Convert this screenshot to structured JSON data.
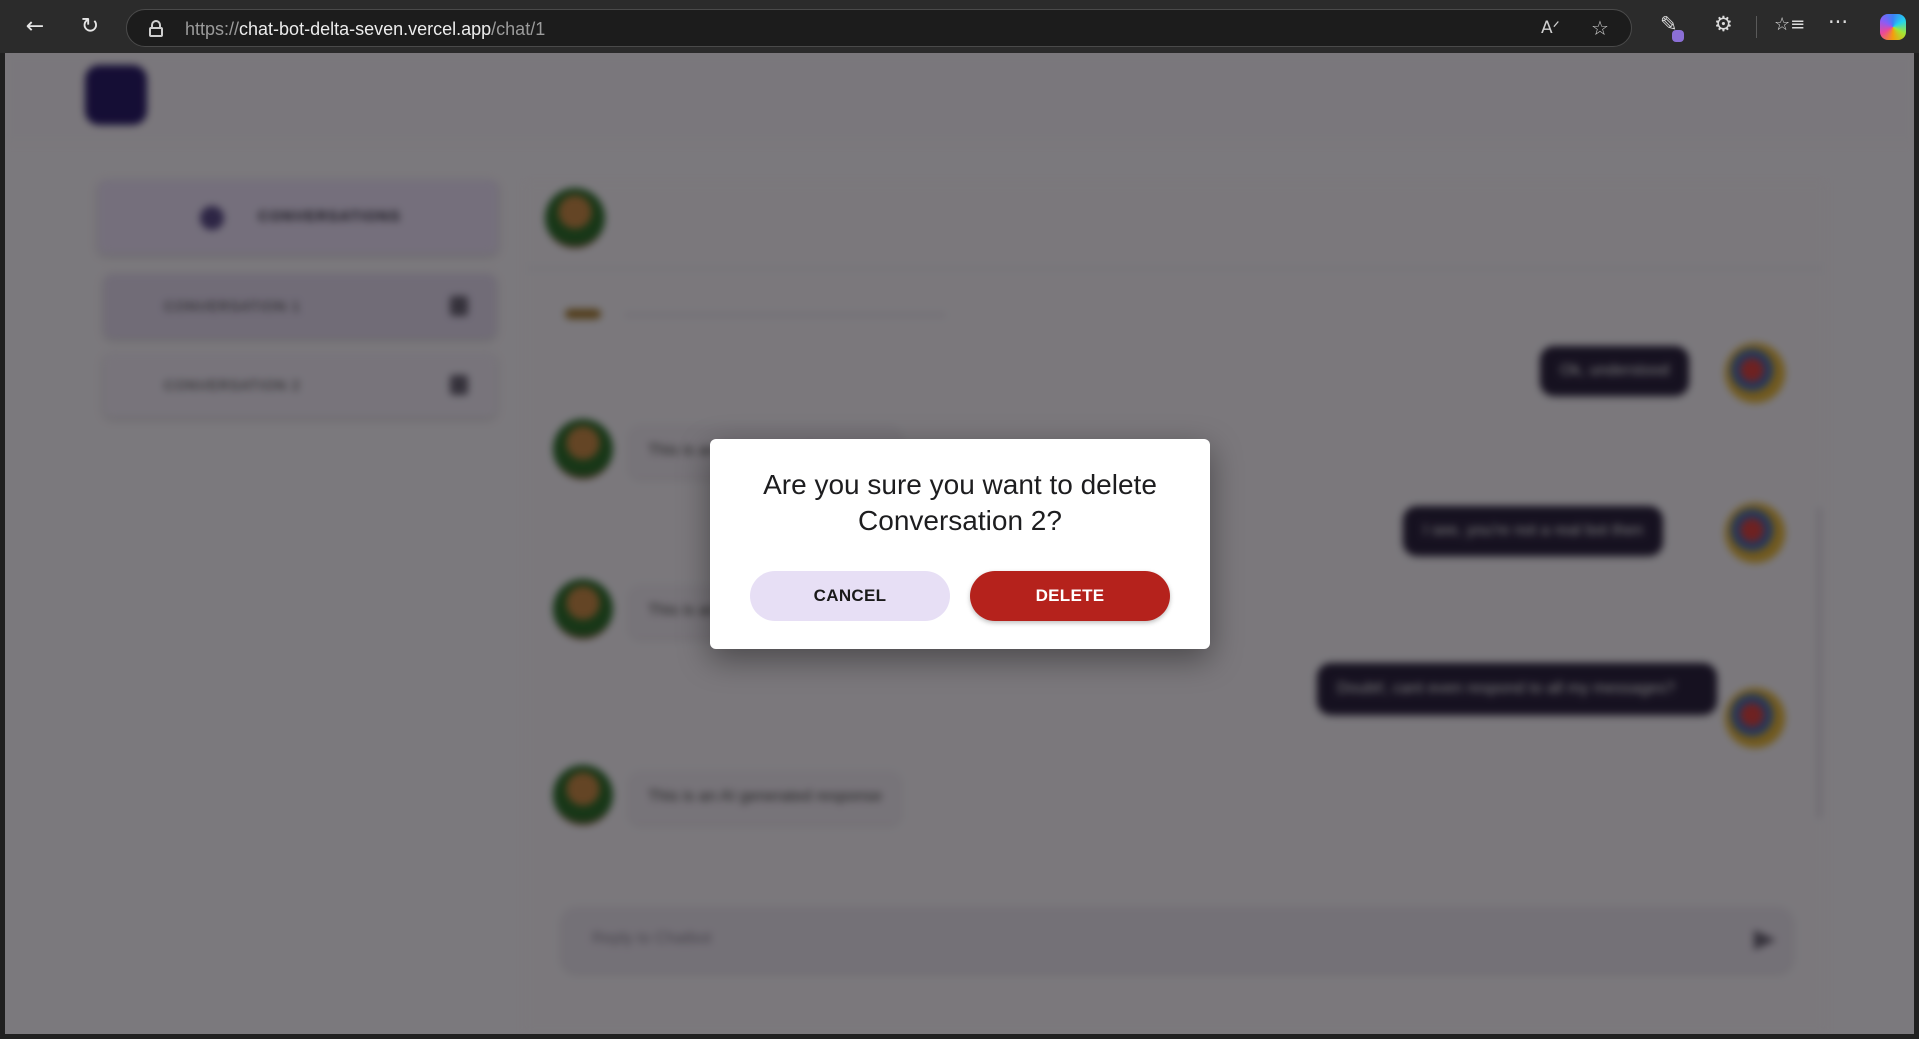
{
  "browser": {
    "url_scheme": "https://",
    "url_host": "chat-bot-delta-seven.vercel.app",
    "url_path": "/chat/1",
    "icons": {
      "back": "←",
      "reload": "↻",
      "read_aloud": "Aᐟ",
      "favorite": "☆",
      "extensions": "⚙",
      "collections": "☆≡",
      "more": "···"
    }
  },
  "sidebar": {
    "header_label": "CONVERSATIONS",
    "conversations": [
      {
        "label": "CONVERSATION 1"
      },
      {
        "label": "CONVERSATION 2"
      }
    ]
  },
  "chat": {
    "messages": [
      {
        "role": "user",
        "text": "Ok, understood"
      },
      {
        "role": "bot",
        "text": "This is an AI generated response"
      },
      {
        "role": "user",
        "text": "I see, you're not a real bot then"
      },
      {
        "role": "bot",
        "text": "This is an AI generated response"
      },
      {
        "role": "user",
        "text": "Doubt!, cant even respond to all my messages?"
      },
      {
        "role": "bot",
        "text": "This is an AI generated response"
      }
    ],
    "input_placeholder": "Reply to Chatbot"
  },
  "dialog": {
    "title": "Are you sure you want to delete Conversation 2?",
    "cancel_label": "CANCEL",
    "delete_label": "DELETE"
  },
  "colors": {
    "accent": "#2b1c6b",
    "delete": "#b5221c",
    "cancel_bg": "#e7dff5",
    "user_bubble": "#2d2341"
  }
}
